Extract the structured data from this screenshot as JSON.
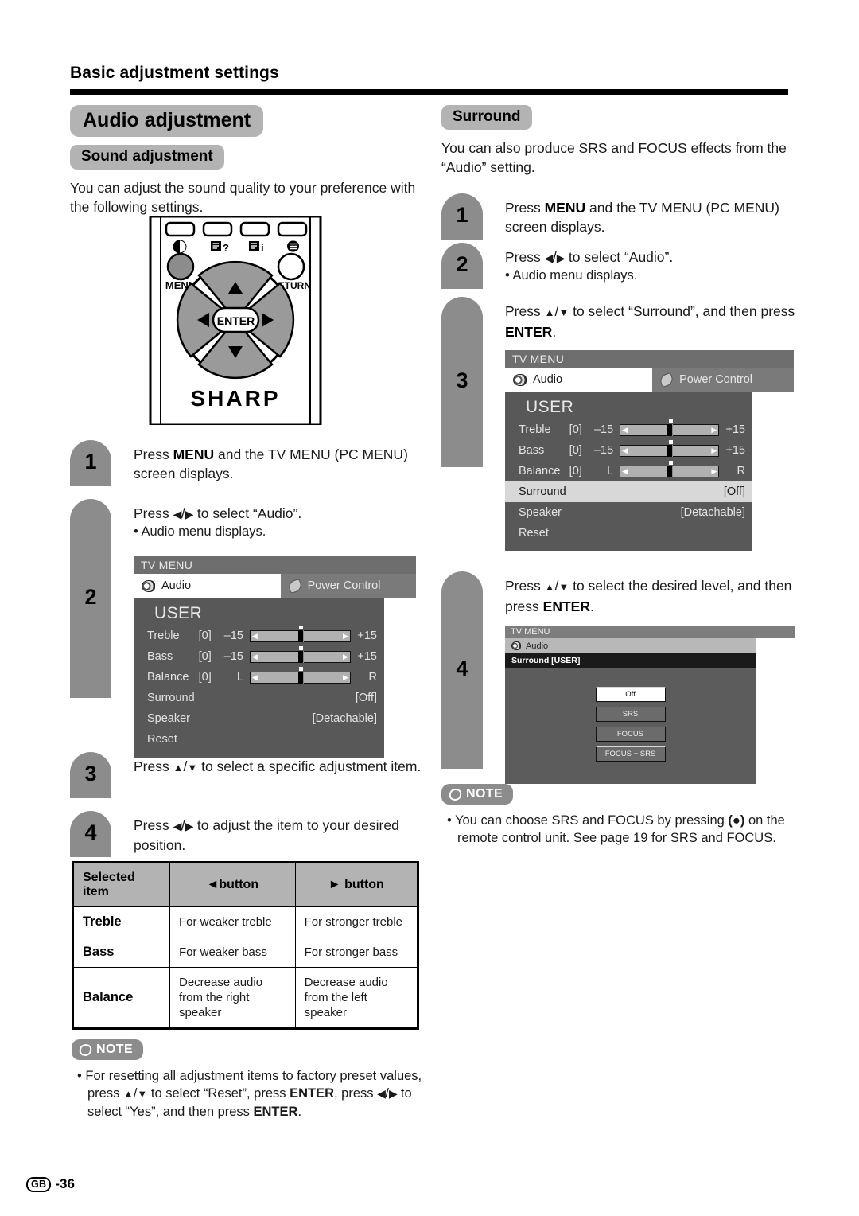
{
  "header": {
    "title": "Basic adjustment settings"
  },
  "left": {
    "h1": "Audio adjustment",
    "h2": "Sound adjustment",
    "intro": "You can adjust the sound quality to your preference with the following settings.",
    "remote": {
      "menu_label": "MENU",
      "return_label": "RETURN",
      "enter_label": "ENTER",
      "brand": "SHARP"
    },
    "steps": [
      {
        "n": "1",
        "text": "Press MENU and the TV MENU (PC MENU) screen displays.",
        "bold": "MENU"
      },
      {
        "n": "2",
        "text": "Press ◄/► to select “Audio”.",
        "bullet": "• Audio menu displays."
      },
      {
        "n": "3",
        "text": "Press ▲/▼ to select a specific adjustment item."
      },
      {
        "n": "4",
        "text": "Press ◄/► to adjust the item to your desired position."
      }
    ],
    "table": {
      "headers": [
        "Selected item",
        "◄button",
        "► button"
      ],
      "rows": [
        {
          "item": "Treble",
          "left": "For weaker treble",
          "right": "For stronger treble"
        },
        {
          "item": "Bass",
          "left": "For weaker bass",
          "right": "For stronger bass"
        },
        {
          "item": "Balance",
          "left": "Decrease audio from the right speaker",
          "right": "Decrease audio from the left speaker"
        }
      ]
    },
    "note": {
      "label": "NOTE",
      "text": "• For resetting all adjustment items to factory preset values, press ▲/▼ to select “Reset”, press ENTER, press ◄/► to select “Yes”, and then press ENTER."
    }
  },
  "right": {
    "h2": "Surround",
    "intro": "You can also produce SRS and FOCUS effects from the “Audio” setting.",
    "steps": [
      {
        "n": "1",
        "text": "Press MENU and the TV MENU (PC MENU) screen displays."
      },
      {
        "n": "2",
        "text": "Press ◄/► to select “Audio”.",
        "bullet": "• Audio menu displays."
      },
      {
        "n": "3",
        "text": "Press ▲/▼ to select “Surround”, and then press ENTER."
      },
      {
        "n": "4",
        "text": "Press ▲/▼ to select the desired level, and then press ENTER."
      }
    ],
    "note": {
      "label": "NOTE",
      "text": "• You can choose SRS and FOCUS by pressing (●) on the remote control unit. See page 19 for SRS and FOCUS."
    }
  },
  "osd": {
    "title": "TV MENU",
    "tab_audio": "Audio",
    "tab_power": "Power Control",
    "user": "USER",
    "rows": [
      {
        "label": "Treble",
        "value": "[0]",
        "min": "–15",
        "max": "+15"
      },
      {
        "label": "Bass",
        "value": "[0]",
        "min": "–15",
        "max": "+15"
      },
      {
        "label": "Balance",
        "value": "[0]",
        "min": "L",
        "max": "R"
      }
    ],
    "surround_label": "Surround",
    "surround_value": "[Off]",
    "speaker_label": "Speaker",
    "speaker_value": "[Detachable]",
    "reset_label": "Reset"
  },
  "osd_surround": {
    "title": "TV MENU",
    "tab_audio": "Audio",
    "subtitle": "Surround [USER]",
    "options": [
      "Off",
      "SRS",
      "FOCUS",
      "FOCUS + SRS"
    ]
  },
  "footer": {
    "region": "GB",
    "page": "-36"
  },
  "colors": {
    "chip": "#b3b3b3",
    "badge": "#8c8c8c",
    "osd_body": "#585858",
    "rule": "#000000"
  }
}
